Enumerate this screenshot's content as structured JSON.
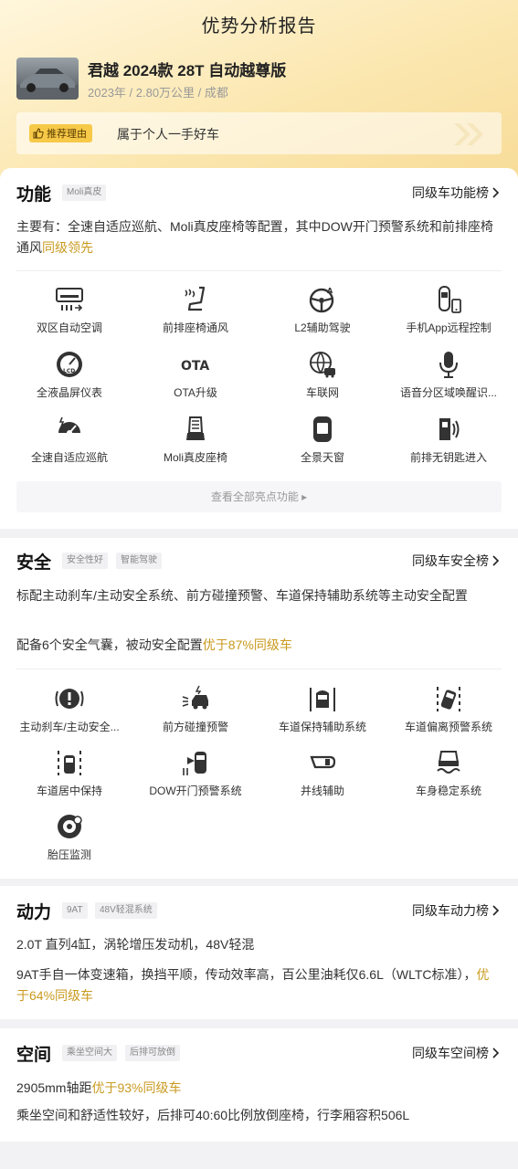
{
  "header": {
    "title": "优势分析报告",
    "car_name": "君越 2024款 28T 自动越尊版",
    "car_meta": "2023年 / 2.80万公里 / 成都",
    "reason_tag": "推荐理由",
    "reason_text": "属于个人一手好车"
  },
  "features": {
    "title": "功能",
    "chips": [
      "Moli真皮"
    ],
    "rank_link": "同级车功能榜",
    "desc_main": "主要有：全速自适应巡航、Moli真皮座椅等配置，其中DOW开门预警系统和前排座椅通风",
    "desc_highlight": "同级领先",
    "items": [
      {
        "label": "双区自动空调",
        "icon": "ac-icon"
      },
      {
        "label": "前排座椅通风",
        "icon": "seat-vent-icon"
      },
      {
        "label": "L2辅助驾驶",
        "icon": "steering-wheel-icon"
      },
      {
        "label": "手机App远程控制",
        "icon": "phone-car-icon"
      },
      {
        "label": "全液晶屏仪表",
        "icon": "lcd-gauge-icon"
      },
      {
        "label": "OTA升级",
        "icon": "ota-icon"
      },
      {
        "label": "车联网",
        "icon": "connected-car-icon"
      },
      {
        "label": "语音分区域唤醒识...",
        "icon": "microphone-icon"
      },
      {
        "label": "全速自适应巡航",
        "icon": "cruise-icon"
      },
      {
        "label": "Moli真皮座椅",
        "icon": "leather-seat-icon"
      },
      {
        "label": "全景天窗",
        "icon": "sunroof-icon"
      },
      {
        "label": "前排无钥匙进入",
        "icon": "keyless-entry-icon"
      }
    ],
    "ota_text": "OTA",
    "lcd_text": "LCD",
    "more_label": "查看全部亮点功能 ▸"
  },
  "safety": {
    "title": "安全",
    "chips": [
      "安全性好",
      "智能驾驶"
    ],
    "rank_link": "同级车安全榜",
    "desc1": "标配主动刹车/主动安全系统、前方碰撞预警、车道保持辅助系统等主动安全配置",
    "desc2_main": "配备6个安全气囊，被动安全配置",
    "desc2_highlight": "优于87%同级车",
    "items": [
      {
        "label": "主动刹车/主动安全...",
        "icon": "brake-warning-icon"
      },
      {
        "label": "前方碰撞预警",
        "icon": "collision-warning-icon"
      },
      {
        "label": "车道保持辅助系统",
        "icon": "lane-keep-icon"
      },
      {
        "label": "车道偏离预警系统",
        "icon": "lane-departure-icon"
      },
      {
        "label": "车道居中保持",
        "icon": "lane-center-icon"
      },
      {
        "label": "DOW开门预警系统",
        "icon": "door-open-warning-icon"
      },
      {
        "label": "并线辅助",
        "icon": "blind-spot-icon"
      },
      {
        "label": "车身稳定系统",
        "icon": "stability-icon"
      },
      {
        "label": "胎压监测",
        "icon": "tire-pressure-icon"
      }
    ]
  },
  "power": {
    "title": "动力",
    "chips": [
      "9AT",
      "48V轻混系统"
    ],
    "rank_link": "同级车动力榜",
    "desc1": "2.0T 直列4缸，涡轮增压发动机，48V轻混",
    "desc2_main": "9AT手自一体变速箱，换挡平顺，传动效率高，百公里油耗仅6.6L（WLTC标准），",
    "desc2_highlight": "优于64%同级车"
  },
  "space": {
    "title": "空间",
    "chips": [
      "乘坐空间大",
      "后排可放倒"
    ],
    "rank_link": "同级车空间榜",
    "desc1_main": "2905mm轴距",
    "desc1_highlight": "优于93%同级车",
    "desc2": "乘坐空间和舒适性较好，后排可40:60比例放倒座椅，行李厢容积506L"
  },
  "colors": {
    "accent": "#c99a1f",
    "tag_bg": "#f7c948",
    "hero_top": "#fff6dc",
    "hero_bottom": "#f8dc98"
  }
}
